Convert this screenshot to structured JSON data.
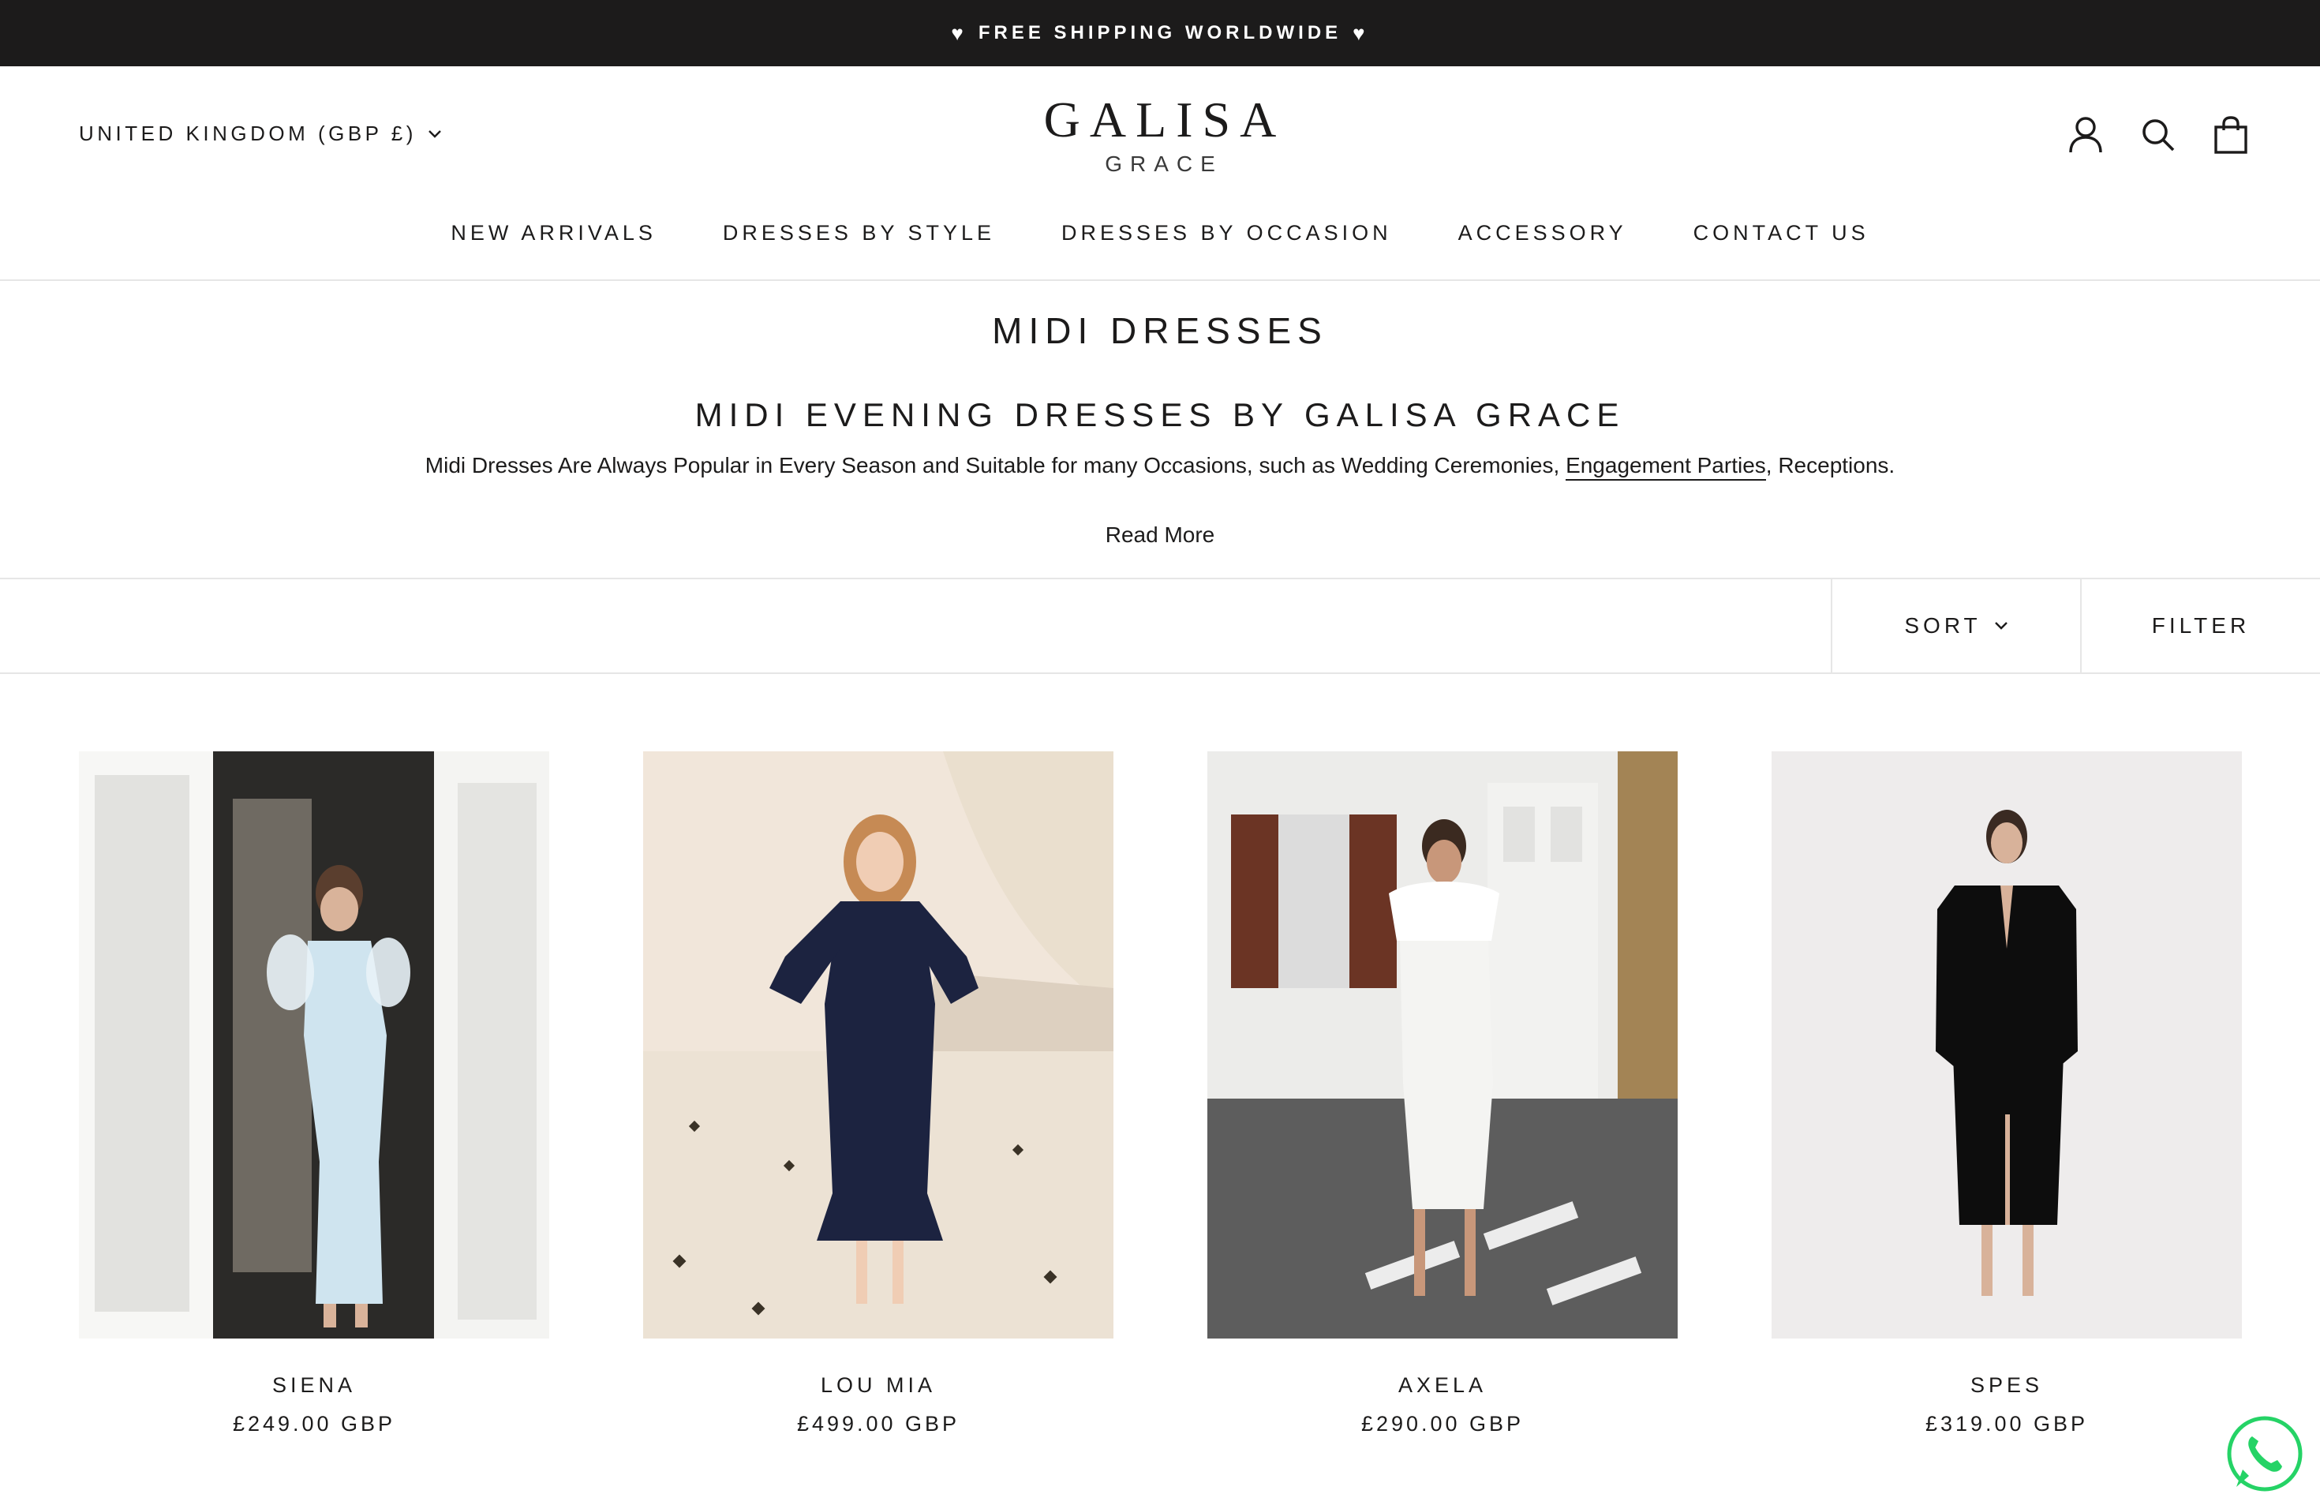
{
  "announcement": {
    "heart_left": "♥",
    "text": "FREE SHIPPING WORLDWIDE",
    "heart_right": "♥"
  },
  "header": {
    "country_selector": "UNITED KINGDOM (GBP £)",
    "logo_line1": "GALISA",
    "logo_line2": "GRACE",
    "icons": [
      "account-icon",
      "search-icon",
      "cart-icon"
    ]
  },
  "nav": {
    "items": [
      "NEW ARRIVALS",
      "DRESSES BY STYLE",
      "DRESSES BY OCCASION",
      "ACCESSORY",
      "CONTACT US"
    ]
  },
  "collection": {
    "title": "MIDI DRESSES",
    "subtitle": "MIDI EVENING DRESSES BY GALISA GRACE",
    "description_before": "Midi Dresses Are Always Popular in Every Season and Suitable for many Occasions, such as Wedding Ceremonies, ",
    "description_link": "Engagement Parties",
    "description_after": ", Receptions.",
    "read_more": "Read More"
  },
  "toolbar": {
    "sort_label": "SORT",
    "filter_label": "FILTER"
  },
  "products": [
    {
      "name": "SIENA",
      "price": "£249.00 GBP"
    },
    {
      "name": "LOU MIA",
      "price": "£499.00 GBP"
    },
    {
      "name": "AXELA",
      "price": "£290.00 GBP"
    },
    {
      "name": "SPES",
      "price": "£319.00 GBP"
    }
  ],
  "colors": {
    "announcement_bg": "#1c1b1b",
    "text": "#1c1b1b",
    "border": "#e6e6e6",
    "whatsapp": "#25d366"
  },
  "floating": {
    "icon": "whatsapp-icon"
  }
}
